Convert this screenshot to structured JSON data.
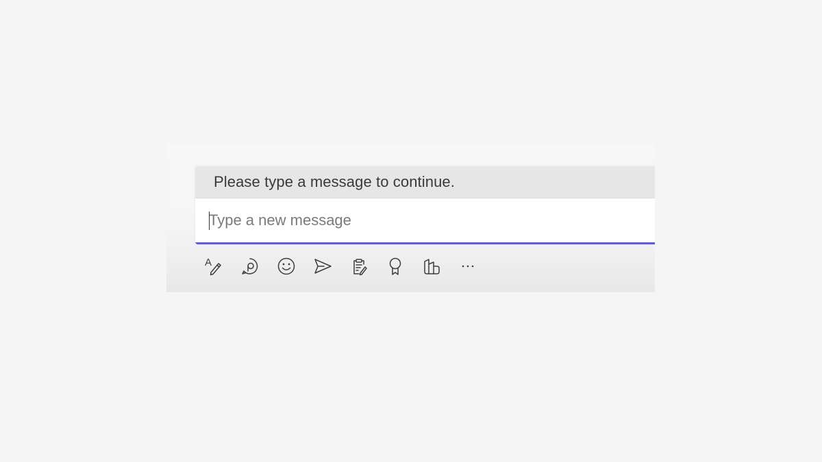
{
  "composer": {
    "banner_text": "Please type a message to continue.",
    "input_placeholder": "Type a new message",
    "input_value": "",
    "accent_color": "#5b5fc7"
  },
  "toolbar": {
    "items": [
      {
        "icon": "format-icon",
        "format_glyph": "A"
      },
      {
        "icon": "loop-component-icon"
      },
      {
        "icon": "emoji-icon"
      },
      {
        "icon": "send-icon"
      },
      {
        "icon": "notes-icon"
      },
      {
        "icon": "praise-icon"
      },
      {
        "icon": "apps-icon"
      },
      {
        "icon": "more-options-icon"
      }
    ]
  }
}
